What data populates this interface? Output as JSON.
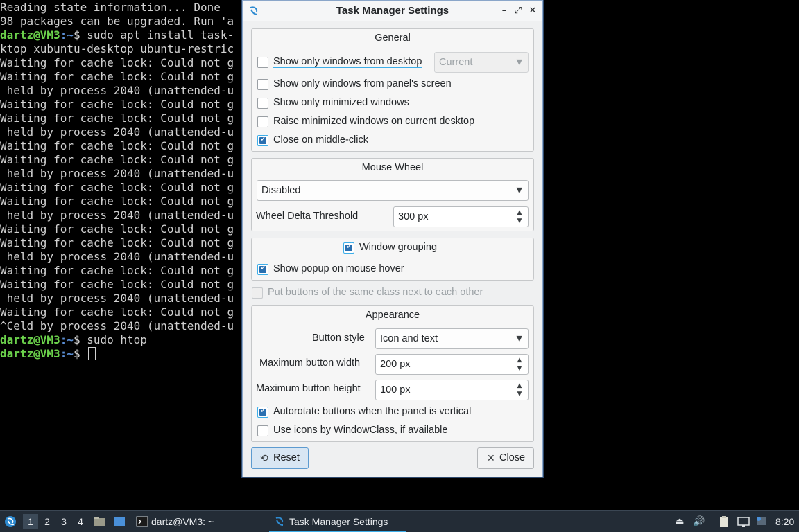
{
  "terminal": {
    "lines": [
      {
        "text": "Reading state information... Done"
      },
      {
        "text": "98 packages can be upgraded. Run 'a"
      },
      {
        "user": "dartz@VM3",
        "path": ":~",
        "cmd": "$ sudo apt install task-"
      },
      {
        "text": "ktop xubuntu-desktop ubuntu-restric"
      },
      {
        "text": "Waiting for cache lock: Could not g"
      },
      {
        "text": "Waiting for cache lock: Could not g"
      },
      {
        "text": " held by process 2040 (unattended-u"
      },
      {
        "text": "Waiting for cache lock: Could not g"
      },
      {
        "text": "Waiting for cache lock: Could not g"
      },
      {
        "text": " held by process 2040 (unattended-u"
      },
      {
        "text": "Waiting for cache lock: Could not g"
      },
      {
        "text": "Waiting for cache lock: Could not g"
      },
      {
        "text": " held by process 2040 (unattended-u"
      },
      {
        "text": "Waiting for cache lock: Could not g"
      },
      {
        "text": "Waiting for cache lock: Could not g"
      },
      {
        "text": " held by process 2040 (unattended-u"
      },
      {
        "text": "Waiting for cache lock: Could not g"
      },
      {
        "text": "Waiting for cache lock: Could not g"
      },
      {
        "text": " held by process 2040 (unattended-u"
      },
      {
        "text": "Waiting for cache lock: Could not g"
      },
      {
        "text": "Waiting for cache lock: Could not g"
      },
      {
        "text": " held by process 2040 (unattended-u"
      },
      {
        "text": "Waiting for cache lock: Could not g"
      },
      {
        "text": "^Celd by process 2040 (unattended-u"
      },
      {
        "user": "dartz@VM3",
        "path": ":~",
        "cmd": "$ sudo htop"
      },
      {
        "user": "dartz@VM3",
        "path": ":~",
        "cmd": "$ ",
        "cursor": true
      }
    ]
  },
  "dialog": {
    "title": "Task Manager Settings",
    "app_icon": "lxqt-icon",
    "controls": {
      "minimize": "minimize-icon",
      "maximize": "maximize-icon",
      "close": "close-icon"
    },
    "general": {
      "title": "General",
      "show_only_desktop": {
        "label": "Show only windows from desktop",
        "checked": false
      },
      "desktop_combo": {
        "value": "Current",
        "enabled": false
      },
      "show_only_panel_screen": {
        "label": "Show only windows from panel's screen",
        "checked": false
      },
      "show_only_minimized": {
        "label": "Show only minimized windows",
        "checked": false
      },
      "raise_minimized": {
        "label": "Raise minimized windows on current desktop",
        "checked": false
      },
      "close_middle_click": {
        "label": "Close on middle-click",
        "checked": true
      }
    },
    "mouse_wheel": {
      "title": "Mouse Wheel",
      "mode": "Disabled",
      "threshold_label": "Wheel Delta Threshold",
      "threshold_value": "300 px"
    },
    "grouping": {
      "window_grouping": {
        "label": "Window grouping",
        "checked": true
      },
      "show_popup": {
        "label": "Show popup on mouse hover",
        "checked": true
      }
    },
    "put_buttons_same_class": {
      "label": "Put buttons of the same class next to each other",
      "checked": false,
      "enabled": false
    },
    "appearance": {
      "title": "Appearance",
      "button_style_label": "Button style",
      "button_style_value": "Icon and text",
      "max_width_label": "Maximum button width",
      "max_width_value": "200 px",
      "max_height_label": "Maximum button height",
      "max_height_value": "100 px",
      "autorotate": {
        "label": "Autorotate buttons when the panel is vertical",
        "checked": true
      },
      "use_icons_windowclass": {
        "label": "Use icons by WindowClass, if available",
        "checked": false
      }
    },
    "buttons": {
      "reset": "Reset",
      "close": "Close"
    }
  },
  "taskbar": {
    "desktops": [
      "1",
      "2",
      "3",
      "4"
    ],
    "active_desktop": "1",
    "tasks": [
      {
        "label": "dartz@VM3: ~",
        "icon": "terminal-icon"
      },
      {
        "label": "Task Manager Settings",
        "icon": "lxqt-icon",
        "active": true
      }
    ],
    "clock": "8:20"
  }
}
